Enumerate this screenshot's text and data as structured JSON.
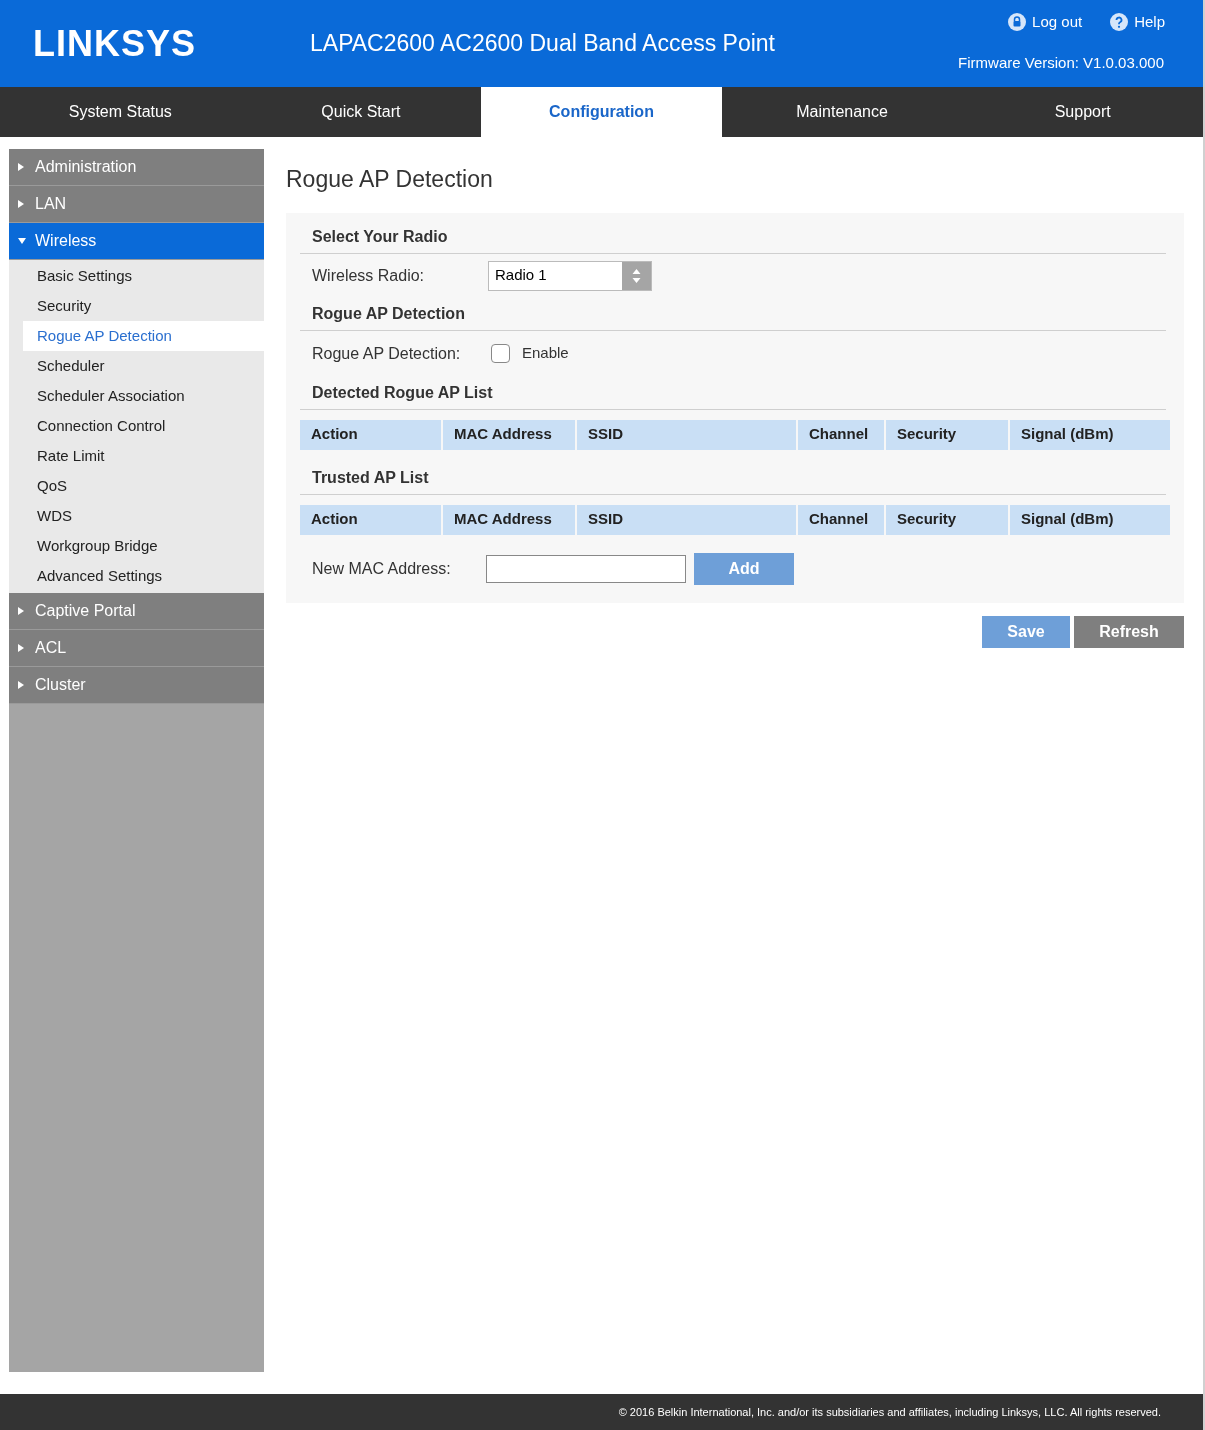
{
  "header": {
    "logo": "LINKSYS",
    "title": "LAPAC2600 AC2600 Dual Band Access Point",
    "logout": "Log out",
    "help": "Help",
    "firmware": "Firmware Version: V1.0.03.000"
  },
  "tabs": [
    {
      "label": "System Status",
      "selected": false
    },
    {
      "label": "Quick Start",
      "selected": false
    },
    {
      "label": "Configuration",
      "selected": true
    },
    {
      "label": "Maintenance",
      "selected": false
    },
    {
      "label": "Support",
      "selected": false
    }
  ],
  "sidebar": {
    "items": [
      {
        "label": "Administration",
        "selected": false,
        "expanded": false
      },
      {
        "label": "LAN",
        "selected": false,
        "expanded": false
      },
      {
        "label": "Wireless",
        "selected": true,
        "expanded": true,
        "children": [
          {
            "label": "Basic Settings",
            "selected": false
          },
          {
            "label": "Security",
            "selected": false
          },
          {
            "label": "Rogue AP Detection",
            "selected": true
          },
          {
            "label": "Scheduler",
            "selected": false
          },
          {
            "label": "Scheduler Association",
            "selected": false
          },
          {
            "label": "Connection Control",
            "selected": false
          },
          {
            "label": "Rate Limit",
            "selected": false
          },
          {
            "label": "QoS",
            "selected": false
          },
          {
            "label": "WDS",
            "selected": false
          },
          {
            "label": "Workgroup Bridge",
            "selected": false
          },
          {
            "label": "Advanced Settings",
            "selected": false
          }
        ]
      },
      {
        "label": "Captive Portal",
        "selected": false,
        "expanded": false
      },
      {
        "label": "ACL",
        "selected": false,
        "expanded": false
      },
      {
        "label": "Cluster",
        "selected": false,
        "expanded": false
      }
    ]
  },
  "page_title": "Rogue AP Detection",
  "sections": [
    {
      "kind": "select",
      "heading": "Select Your Radio",
      "label": "Wireless Radio:",
      "value": "Radio 1"
    },
    {
      "kind": "checkbox",
      "heading": "Rogue AP Detection",
      "label": "Rogue AP Detection:",
      "option": "Enable",
      "checked": false
    },
    {
      "kind": "table",
      "heading": "Detected Rogue AP List",
      "columns": [
        "Action",
        "MAC Address",
        "SSID",
        "Channel",
        "Security",
        "Signal (dBm)"
      ]
    },
    {
      "kind": "table",
      "heading": "Trusted AP List",
      "columns": [
        "Action",
        "MAC Address",
        "SSID",
        "Channel",
        "Security",
        "Signal (dBm)"
      ]
    },
    {
      "kind": "input",
      "label": "New MAC Address:",
      "button": "Add"
    }
  ],
  "buttons": [
    {
      "label": "Save",
      "kind": "primary"
    },
    {
      "label": "Refresh",
      "kind": "secondary"
    }
  ],
  "footer": "© 2016 Belkin International, Inc. and/or its subsidiaries and affiliates, including Linksys, LLC. All rights reserved."
}
